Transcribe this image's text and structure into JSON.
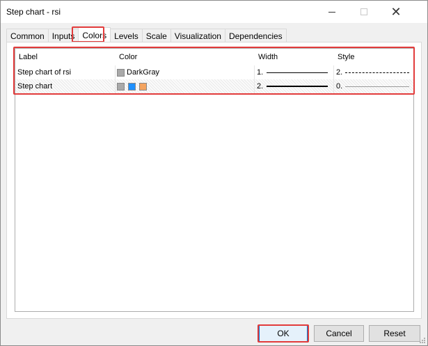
{
  "window": {
    "title": "Step chart - rsi"
  },
  "tabs": [
    {
      "label": "Common"
    },
    {
      "label": "Inputs"
    },
    {
      "label": "Colors"
    },
    {
      "label": "Levels"
    },
    {
      "label": "Scale"
    },
    {
      "label": "Visualization"
    },
    {
      "label": "Dependencies"
    }
  ],
  "active_tab": "Colors",
  "grid": {
    "columns": [
      "Label",
      "Color",
      "Width",
      "Style"
    ],
    "rows": [
      {
        "label": "Step chart of rsi",
        "colors": [
          "#a9a9a9"
        ],
        "color_name": "DarkGray",
        "width_text": "1.",
        "style_text": "2."
      },
      {
        "label": "Step chart",
        "colors": [
          "#a9a9a9",
          "#1e90ff",
          "#f4a460"
        ],
        "color_name": "",
        "width_text": "2.",
        "style_text": "0."
      }
    ]
  },
  "buttons": {
    "ok": "OK",
    "cancel": "Cancel",
    "reset": "Reset"
  },
  "highlight_color": "#e23b3b"
}
